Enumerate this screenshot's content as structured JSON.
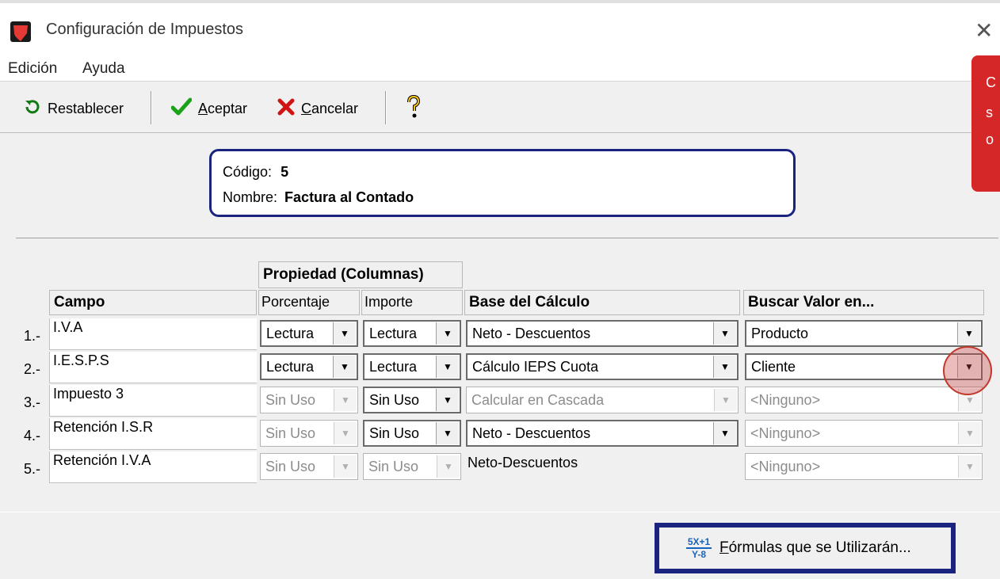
{
  "window": {
    "title": "Configuración de Impuestos"
  },
  "menu": {
    "items": [
      "Edición",
      "Ayuda"
    ]
  },
  "toolbar": {
    "restablecer": "Restablecer",
    "aceptar_u": "A",
    "aceptar_rest": "ceptar",
    "cancelar_u": "C",
    "cancelar_rest": "ancelar"
  },
  "info": {
    "codigo_label": "Código:",
    "codigo_value": "5",
    "nombre_label": "Nombre:",
    "nombre_value": "Factura al Contado"
  },
  "table": {
    "group_header": "Propiedad (Columnas)",
    "col_campo": "Campo",
    "col_porcentaje": "Porcentaje",
    "col_importe": "Importe",
    "col_base": "Base del Cálculo",
    "col_buscar": "Buscar Valor en...",
    "rows": [
      {
        "num": "1.-",
        "campo": "I.V.A",
        "porcentaje": "Lectura",
        "importe": "Lectura",
        "base": "Neto - Descuentos",
        "buscar": "Producto"
      },
      {
        "num": "2.-",
        "campo": "I.E.S.P.S",
        "porcentaje": "Lectura",
        "importe": "Lectura",
        "base": "Cálculo IEPS Cuota",
        "buscar": "Cliente"
      },
      {
        "num": "3.-",
        "campo": "Impuesto 3",
        "porcentaje": "Sin Uso",
        "importe": "Sin Uso",
        "base": "Calcular en Cascada",
        "buscar": "<Ninguno>"
      },
      {
        "num": "4.-",
        "campo": "Retención I.S.R",
        "porcentaje": "Sin Uso",
        "importe": "Sin Uso",
        "base": "Neto - Descuentos",
        "buscar": "<Ninguno>"
      },
      {
        "num": "5.-",
        "campo": "Retención I.V.A",
        "porcentaje": "Sin Uso",
        "importe": "Sin Uso",
        "base": "Neto-Descuentos",
        "buscar": "<Ninguno>"
      }
    ]
  },
  "formula_button": {
    "icon_top": "5X+1",
    "icon_bottom": "Y-8",
    "label_u": "F",
    "label_rest": "órmulas que se Utilizarán..."
  },
  "tooltip": {
    "lines": [
      "C",
      "s",
      "o"
    ]
  },
  "colors": {
    "accent": "#1a237e",
    "tooltip_red": "#d62728",
    "check_green": "#1aa31a",
    "cancel_red": "#d01414"
  }
}
